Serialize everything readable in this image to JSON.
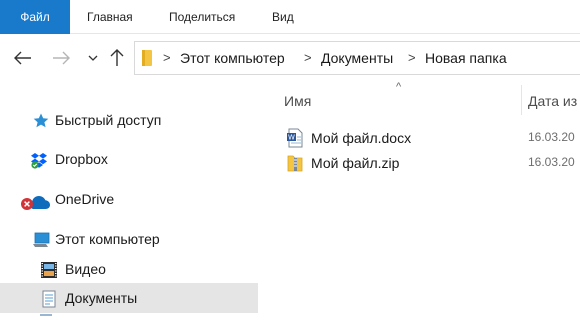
{
  "ribbon": {
    "tabs": [
      "Файл",
      "Главная",
      "Поделиться",
      "Вид"
    ],
    "colors": {
      "file_tab_bg": "#1979ca"
    }
  },
  "nav": {
    "back_icon": "arrow-left-icon",
    "forward_icon": "arrow-right-icon",
    "recent_icon": "chevron-down-icon",
    "up_icon": "arrow-up-icon"
  },
  "address": {
    "separator": ">",
    "crumbs": [
      "Этот компьютер",
      "Документы",
      "Новая папка"
    ]
  },
  "sidebar": {
    "items": [
      {
        "label": "Быстрый доступ",
        "icon": "star-icon"
      },
      {
        "label": "Dropbox",
        "icon": "dropbox-icon"
      },
      {
        "label": "OneDrive",
        "icon": "onedrive-cloud-error-icon"
      },
      {
        "label": "Этот компьютер",
        "icon": "computer-icon"
      },
      {
        "label": "Видео",
        "icon": "video-folder-icon"
      },
      {
        "label": "Документы",
        "icon": "documents-folder-icon",
        "selected": true
      }
    ]
  },
  "columns": {
    "name": "Имя",
    "date": "Дата из",
    "sort_indicator": "^"
  },
  "files": [
    {
      "name": "Мой файл.docx",
      "icon": "docx-file-icon",
      "date": "16.03.20"
    },
    {
      "name": "Мой файл.zip",
      "icon": "zip-file-icon",
      "date": "16.03.20"
    }
  ]
}
